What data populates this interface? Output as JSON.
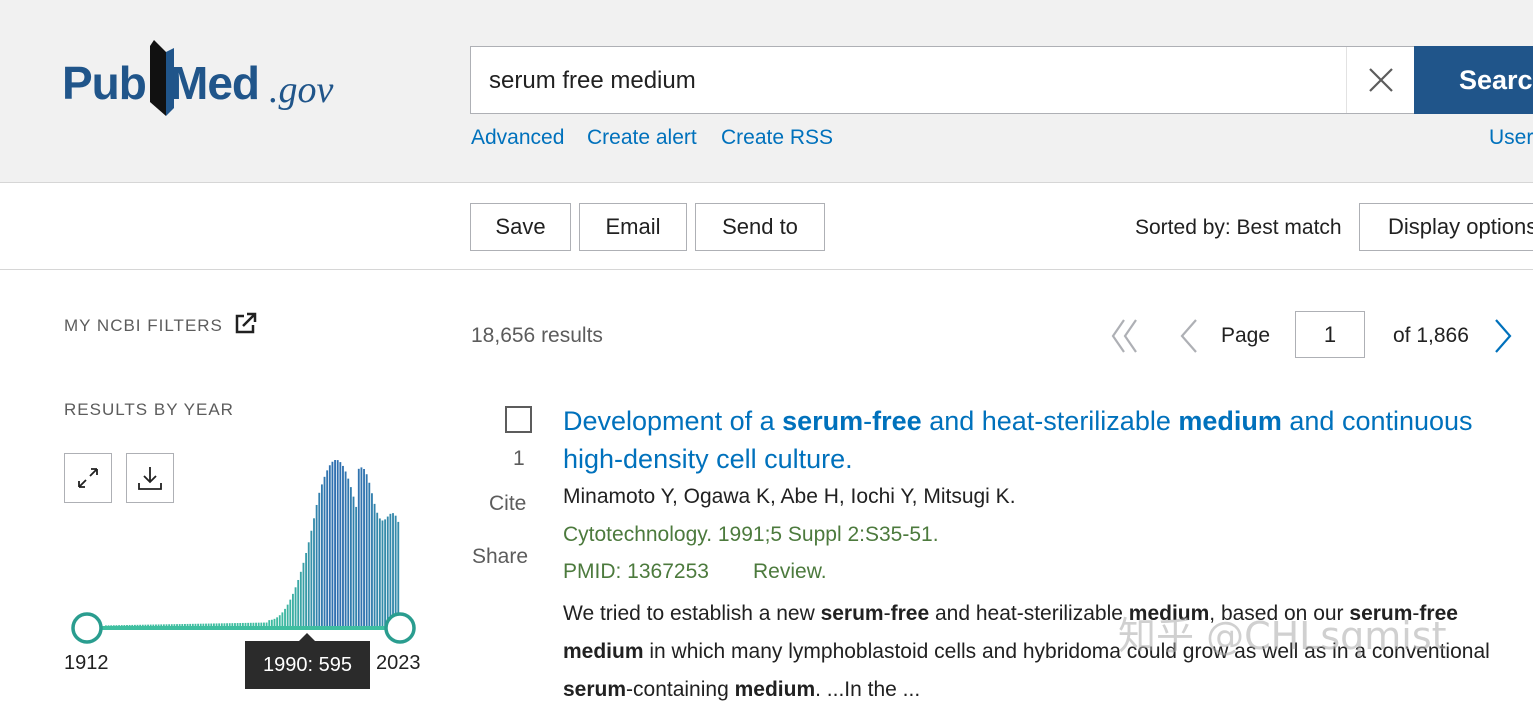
{
  "logo": {
    "pub": "Pub",
    "med": "Med",
    "gov": ".gov"
  },
  "search": {
    "value": "serum free medium",
    "button_label": "Search"
  },
  "header_links": {
    "advanced": "Advanced",
    "create_alert": "Create alert",
    "create_rss": "Create RSS",
    "user_guide": "User Guide"
  },
  "toolbar": {
    "save": "Save",
    "email": "Email",
    "send_to": "Send to",
    "sorted_by": "Sorted by: Best match",
    "display_options": "Display options"
  },
  "sidebar": {
    "my_ncbi_filters": "MY NCBI FILTERS",
    "results_by_year": "RESULTS BY YEAR",
    "year_start": "1912",
    "year_end": "2023",
    "tooltip": "1990: 595"
  },
  "results": {
    "count": "18,656 results",
    "page_label": "Page",
    "page_value": "1",
    "page_of": "of 1,866"
  },
  "result1": {
    "number": "1",
    "cite": "Cite",
    "share": "Share",
    "title_parts": [
      "Development of a ",
      "serum",
      "-",
      "free",
      " and heat-sterilizable ",
      "medium",
      " and continuous high-density cell culture."
    ],
    "authors": "Minamoto Y, Ogawa K, Abe H, Iochi Y, Mitsugi K.",
    "citation": "Cytotechnology. 1991;5 Suppl 2:S35-51.",
    "pmid": "PMID: 1367253",
    "pubtype": "Review.",
    "snippet_parts": [
      "We tried to establish a new ",
      "serum",
      "-",
      "free",
      " and heat-sterilizable ",
      "medium",
      ", based on our ",
      "serum",
      "-",
      "free",
      " ",
      "medium",
      " in which many lymphoblastoid cells and hybridoma could grow as well as in a conventional ",
      "serum",
      "-containing ",
      "medium",
      ". ...In the ..."
    ]
  },
  "watermark": "知乎 @CHLsqmist",
  "chart_data": {
    "type": "bar",
    "title": "",
    "x_range": [
      1912,
      2023
    ],
    "highlight": {
      "year": 1990,
      "value": 595
    },
    "colors": {
      "low": "#3fbfa0",
      "high": "#2f6fb0"
    }
  }
}
